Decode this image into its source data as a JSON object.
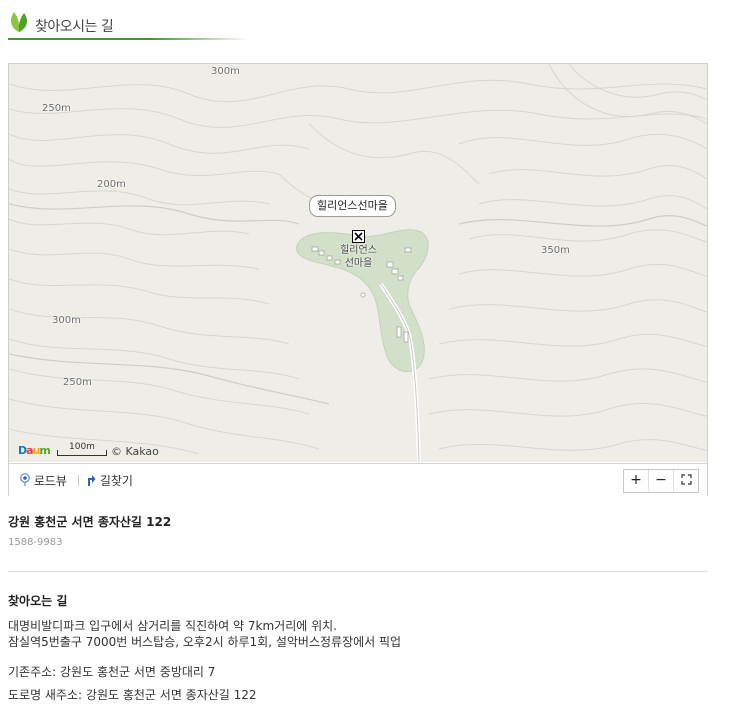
{
  "section": {
    "title": "찾아오시는 길"
  },
  "map": {
    "place_bubble": "힐리언스선마을",
    "place_label_line1": "힐리언스",
    "place_label_line2": "선마을",
    "elevations": [
      "300m",
      "250m",
      "200m",
      "350m",
      "300m",
      "250m"
    ],
    "logo": "Daum",
    "scale": "100m",
    "copyright": "© Kakao",
    "toolbar": {
      "roadview": "로드뷰",
      "directions": "길찾기",
      "zoom_in": "+",
      "zoom_out": "−",
      "fullscreen": "⛶"
    }
  },
  "address": {
    "title": "강원 홍천군 서면 종자산길 122",
    "phone": "1588-9983"
  },
  "directions": {
    "title": "찾아오는 길",
    "line1": "대명비발디파크 입구에서 삼거리를 직진하여 약 7km거리에 위치.",
    "line2": "잠실역5번출구 7000번 버스탑승, 오후2시 하루1회, 설악버스정류장에서 픽업",
    "old_address": "기존주소: 강원도 홍천군 서면 중방대리 7",
    "road_address": "도로명 새주소: 강원도 홍천군 서면 종자산길 122"
  },
  "colors": {
    "accent": "#3e9a2c",
    "map_bg": "#eeede8",
    "park": "#d3e0c9"
  }
}
